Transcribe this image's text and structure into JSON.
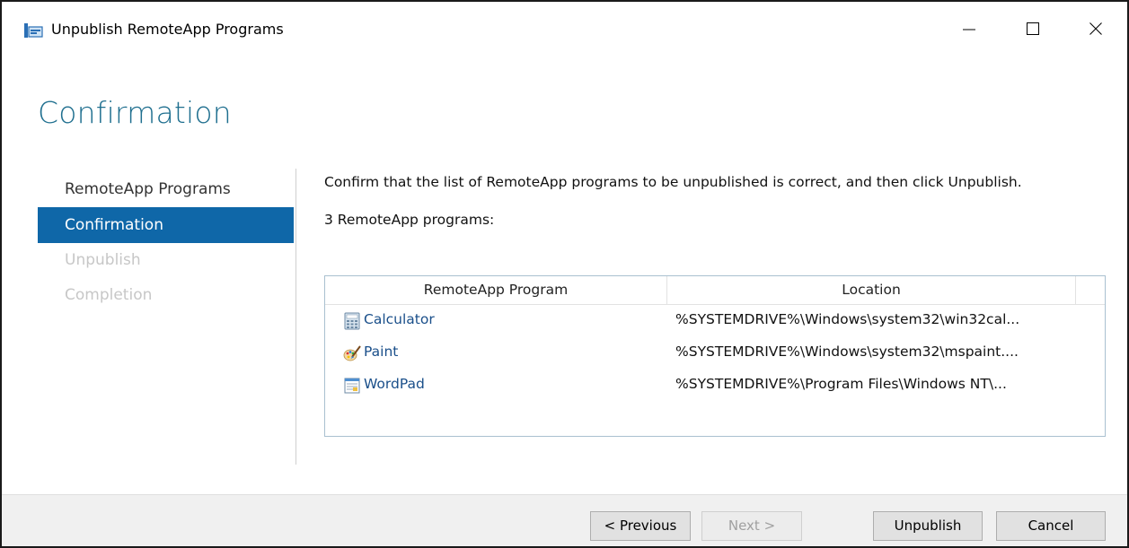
{
  "window": {
    "title": "Unpublish RemoteApp Programs",
    "controls": {
      "minimize_icon": "minimize-icon",
      "maximize_icon": "maximize-icon",
      "close_icon": "close-icon"
    }
  },
  "page": {
    "title": "Confirmation"
  },
  "nav": {
    "items": [
      {
        "label": "RemoteApp Programs",
        "state": "normal"
      },
      {
        "label": "Confirmation",
        "state": "active"
      },
      {
        "label": "Unpublish",
        "state": "disabled"
      },
      {
        "label": "Completion",
        "state": "disabled"
      }
    ]
  },
  "content": {
    "instruction": "Confirm that the list of RemoteApp programs to be unpublished is correct, and then click Unpublish.",
    "count_label": "3 RemoteApp programs:"
  },
  "table": {
    "columns": [
      "RemoteApp Program",
      "Location"
    ],
    "rows": [
      {
        "program": "Calculator",
        "icon": "calculator-icon",
        "location": "%SYSTEMDRIVE%\\Windows\\system32\\win32cal..."
      },
      {
        "program": "Paint",
        "icon": "paint-icon",
        "location": "%SYSTEMDRIVE%\\Windows\\system32\\mspaint...."
      },
      {
        "program": "WordPad",
        "icon": "wordpad-icon",
        "location": "%SYSTEMDRIVE%\\Program Files\\Windows NT\\..."
      }
    ]
  },
  "footer": {
    "previous_label": "< Previous",
    "next_label": "Next >",
    "unpublish_label": "Unpublish",
    "cancel_label": "Cancel"
  },
  "colors": {
    "accent": "#0f67a8",
    "heading": "#1f6f8f",
    "disabled_text": "#c7c7c7"
  }
}
